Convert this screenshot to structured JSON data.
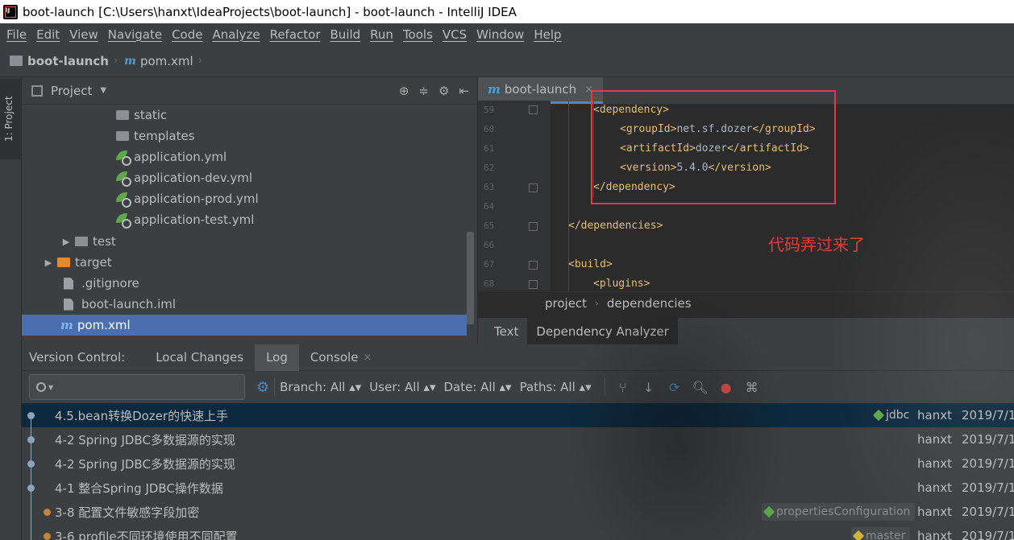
{
  "window": {
    "title": "boot-launch [C:\\Users\\hanxt\\IdeaProjects\\boot-launch] - boot-launch - IntelliJ IDEA"
  },
  "menu": [
    "File",
    "Edit",
    "View",
    "Navigate",
    "Code",
    "Analyze",
    "Refactor",
    "Build",
    "Run",
    "Tools",
    "VCS",
    "Window",
    "Help"
  ],
  "navbar": {
    "project": "boot-launch",
    "file": "pom.xml"
  },
  "left_stripe": {
    "project_tab": "1: Project"
  },
  "project_panel": {
    "title": "Project",
    "tree": [
      {
        "label": "static",
        "kind": "folder"
      },
      {
        "label": "templates",
        "kind": "folder"
      },
      {
        "label": "application.yml",
        "kind": "spring"
      },
      {
        "label": "application-dev.yml",
        "kind": "spring"
      },
      {
        "label": "application-prod.yml",
        "kind": "spring"
      },
      {
        "label": "application-test.yml",
        "kind": "spring"
      },
      {
        "label": "test",
        "kind": "folder"
      },
      {
        "label": "target",
        "kind": "folder-orange"
      },
      {
        "label": ".gitignore",
        "kind": "file"
      },
      {
        "label": "boot-launch.iml",
        "kind": "file"
      },
      {
        "label": "pom.xml",
        "kind": "maven"
      }
    ]
  },
  "editor": {
    "tab_label": "boot-launch",
    "lines": [
      {
        "num": "59",
        "parts": [
          [
            "tag",
            "<dependency>"
          ]
        ]
      },
      {
        "num": "60",
        "parts": [
          [
            "tag",
            "<groupId>"
          ],
          [
            "txt",
            "net.sf.dozer"
          ],
          [
            "tag",
            "</groupId>"
          ]
        ]
      },
      {
        "num": "61",
        "parts": [
          [
            "tag",
            "<artifactId>"
          ],
          [
            "txt",
            "dozer"
          ],
          [
            "tag",
            "</artifactId>"
          ]
        ]
      },
      {
        "num": "62",
        "parts": [
          [
            "tag",
            "<version>"
          ],
          [
            "txt",
            "5.4.0"
          ],
          [
            "tag",
            "</version>"
          ]
        ]
      },
      {
        "num": "63",
        "parts": [
          [
            "tag",
            "</dependency>"
          ]
        ]
      },
      {
        "num": "64",
        "parts": []
      },
      {
        "num": "65",
        "parts": [
          [
            "tag",
            "</dependencies>"
          ]
        ]
      },
      {
        "num": "66",
        "parts": []
      },
      {
        "num": "67",
        "parts": [
          [
            "tag",
            "<build>"
          ]
        ]
      },
      {
        "num": "68",
        "parts": [
          [
            "tag",
            "<plugins>"
          ]
        ]
      }
    ],
    "annotation": "代码弄过来了",
    "breadcrumbs": [
      "project",
      "dependencies"
    ],
    "bottom_tabs": [
      "Text",
      "Dependency Analyzer"
    ]
  },
  "version_control": {
    "label": "Version Control:",
    "tabs": [
      "Local Changes",
      "Log",
      "Console"
    ],
    "filters": [
      "Branch: All",
      "User: All",
      "Date: All",
      "Paths: All"
    ],
    "commits": [
      {
        "message": "4.5.bean转换Dozer的快速上手",
        "tag": "jdbc",
        "author": "hanxt",
        "date": "2019/7/1"
      },
      {
        "message": "4-2 Spring JDBC多数据源的实现",
        "tag": "",
        "author": "hanxt",
        "date": "2019/7/1"
      },
      {
        "message": "4-2 Spring JDBC多数据源的实现",
        "tag": "",
        "author": "hanxt",
        "date": "2019/7/1"
      },
      {
        "message": "4-1 整合Spring JDBC操作数据",
        "tag": "",
        "author": "hanxt",
        "date": "2019/7/1"
      },
      {
        "message": "3-8 配置文件敏感字段加密",
        "tag": "propertiesConfiguration",
        "author": "hanxt",
        "date": "2019/7/1"
      },
      {
        "message": "3-6 profile不同环境使用不同配置",
        "tag": "master",
        "author": "hanxt",
        "date": "2019/7/1"
      }
    ]
  },
  "colors": {
    "accent": "#4a88c7",
    "annotation_red": "#e63b3b",
    "selection": "#4b6eaf"
  }
}
